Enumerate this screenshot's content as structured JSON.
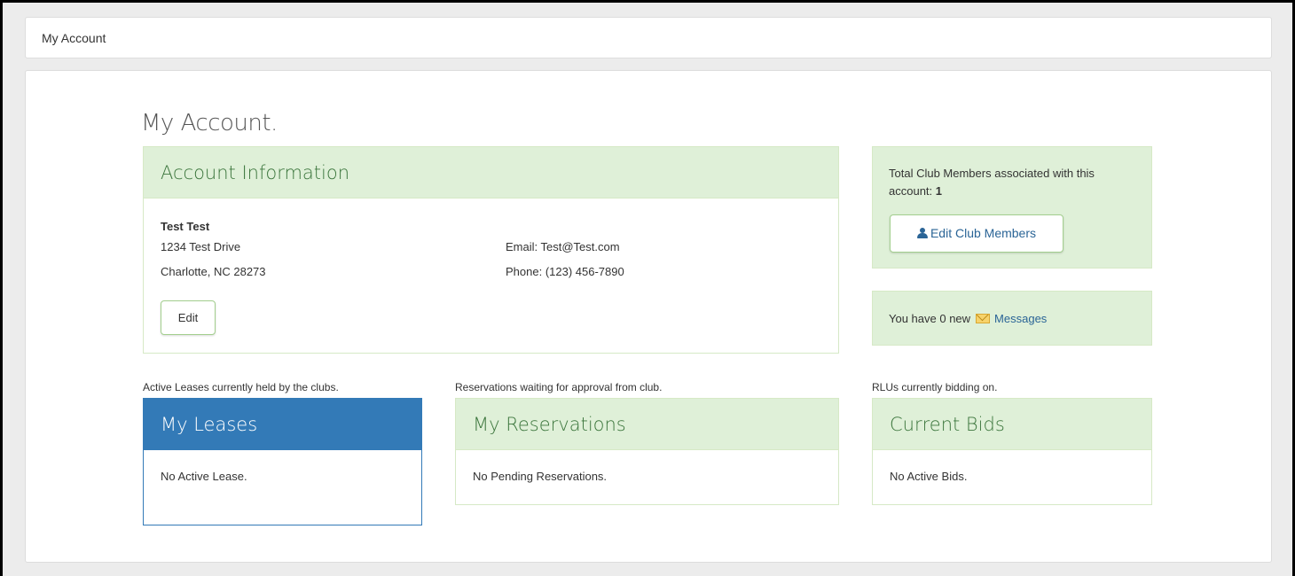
{
  "breadcrumb": {
    "label": "My Account"
  },
  "page": {
    "title": "My Account."
  },
  "account": {
    "header": "Account Information",
    "name": "Test Test",
    "address_line1": "1234 Test Drive",
    "address_line2": "Charlotte, NC 28273",
    "email": "Email: Test@Test.com",
    "phone": "Phone: (123) 456-7890",
    "edit_label": "Edit"
  },
  "members": {
    "text": "Total Club Members associated with this account:",
    "count": "1",
    "button_label": "Edit Club Members",
    "button_icon": "user-icon"
  },
  "messages": {
    "prefix": "You have 0 new",
    "icon": "mail-icon",
    "link_label": "Messages"
  },
  "leases": {
    "caption": "Active Leases currently held by the clubs.",
    "header": "My Leases",
    "body": "No Active Lease."
  },
  "reservations": {
    "caption": "Reservations waiting for approval from club.",
    "header": "My Reservations",
    "body": "No Pending Reservations."
  },
  "bids": {
    "caption": "RLUs currently bidding on.",
    "header": "Current Bids",
    "body": "No Active Bids."
  },
  "colors": {
    "success_bg": "#dff0d8",
    "success_border": "#d6e9c6",
    "success_text": "#3c763d",
    "primary": "#337ab7",
    "link": "#2a6496"
  }
}
